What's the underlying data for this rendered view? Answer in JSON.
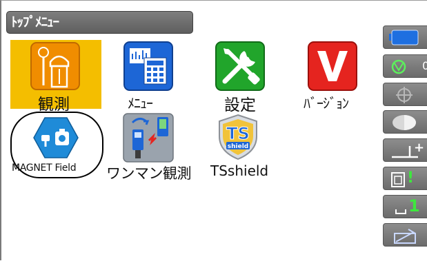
{
  "title": "ﾄｯﾌﾟﾒﾆｭｰ",
  "apps": [
    {
      "label": "観測",
      "icon": "surveyor-icon",
      "selected": true
    },
    {
      "label": "ﾒﾆｭｰ",
      "icon": "menu-calc-icon"
    },
    {
      "label": "設定",
      "icon": "settings-tools-icon"
    },
    {
      "label": "ﾊﾞｰｼﾞｮﾝ",
      "icon": "version-v-icon"
    },
    {
      "label": "MAGNET Field",
      "icon": "magnet-field-icon",
      "highlighted_by_circle": true
    },
    {
      "label": "ワンマン観測",
      "icon": "one-man-survey-icon"
    },
    {
      "label": "TSshield",
      "icon": "tsshield-icon",
      "badge_text": "TS",
      "badge_sub": "shield"
    }
  ],
  "sidebar": {
    "items": [
      {
        "icon": "battery-icon"
      },
      {
        "icon": "target-status-icon",
        "text": "0"
      },
      {
        "icon": "crosshair-icon"
      },
      {
        "icon": "half-circle-icon"
      },
      {
        "icon": "prism-constant-icon",
        "text": "+"
      },
      {
        "icon": "tilt-warning-icon",
        "text": "!"
      },
      {
        "icon": "measure-mode-icon",
        "text": "1"
      },
      {
        "icon": "keyboard-input-icon"
      }
    ]
  },
  "colors": {
    "selection": "#f4be00",
    "titlebar": "#6e6e6e",
    "accent_green": "#3ec83e",
    "sidebar_blue": "#1e6fe0"
  }
}
